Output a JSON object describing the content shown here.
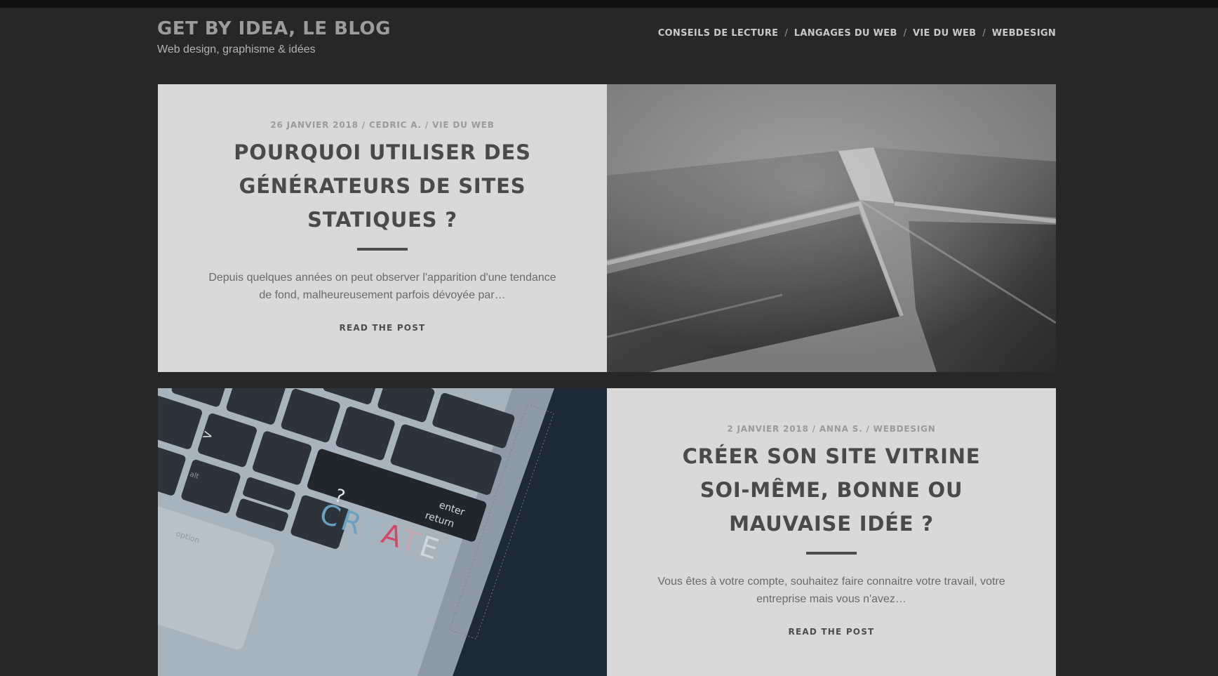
{
  "site": {
    "title": "GET BY IDEA, LE BLOG",
    "tagline": "Web design, graphisme & idées"
  },
  "nav": {
    "items": [
      "CONSEILS DE LECTURE",
      "LANGAGES DU WEB",
      "VIE DU WEB",
      "WEBDESIGN"
    ],
    "separator": "/"
  },
  "posts": [
    {
      "date": "26 JANVIER 2018",
      "author": "CEDRIC A.",
      "category": "VIE DU WEB",
      "title": "POURQUOI UTILISER DES GÉNÉRATEURS DE SITES STATIQUES ?",
      "excerpt": "Depuis quelques années on peut observer l'apparition d'une tendance de fond, malheureusement parfois dévoyée par…",
      "read_more": "READ THE POST",
      "image": "solar-panel-image"
    },
    {
      "date": "2 JANVIER 2018",
      "author": "ANNA S.",
      "category": "WEBDESIGN",
      "title": "CRÉER SON SITE VITRINE SOI-MÊME, BONNE OU MAUVAISE IDÉE ?",
      "excerpt": "Vous êtes à votre compte, souhaitez faire connaitre votre travail, votre entreprise mais vous n'avez…",
      "read_more": "READ THE POST",
      "image": "laptop-keyboard-image"
    }
  ],
  "keyboard_image": {
    "key_create": "CREATE",
    "key_return": "return",
    "key_enter": "enter",
    "key_option": "option",
    "key_alt": "alt"
  }
}
